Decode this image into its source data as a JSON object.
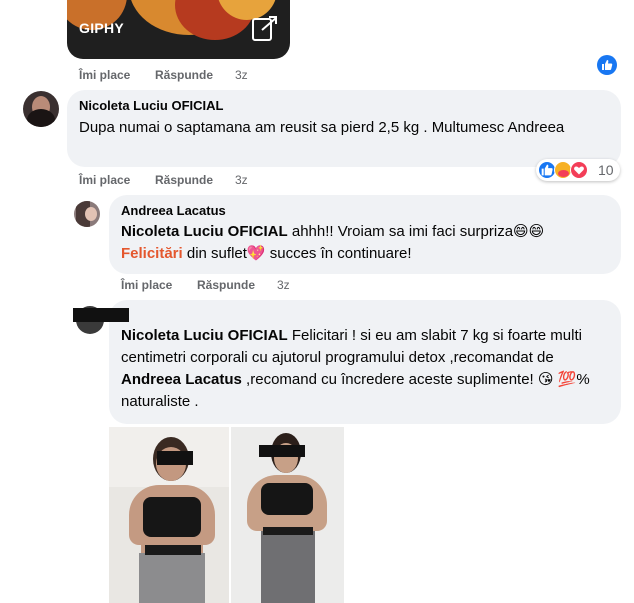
{
  "gif": {
    "label": "GIPHY"
  },
  "actions": {
    "like": "Îmi place",
    "reply": "Răspunde"
  },
  "comments": [
    {
      "time": "3z"
    },
    {
      "author": "Nicoleta Luciu OFICIAL",
      "text": "Dupa numai o saptamana am reusit sa pierd 2,5 kg . Multumesc Andreea",
      "time": "3z",
      "reaction_count": "10",
      "reaction_icons": [
        "like-icon",
        "care-icon",
        "love-icon"
      ]
    },
    {
      "author": "Andreea Lacatus",
      "mention": "Nicoleta Luciu OFICIAL",
      "text_a": " ahhh!! Vroiam sa imi faci surpriza😄😄",
      "felicitari": "Felicitări",
      "text_b": " din suflet💖 succes în continuare!",
      "time": "3z"
    },
    {
      "mention": "Nicoleta Luciu OFICIAL",
      "text_a": " Felicitari ! si eu am slabit 7 kg si foarte multi centimetri corporali cu ajutorul programului detox ,recomandat de ",
      "mention2": "Andreea Lacatus",
      "text_b": " ,recomand cu încredere aceste suplimente! 😘 💯% naturaliste ."
    }
  ],
  "colors": {
    "bubble": "#f0f2f5",
    "secondary_text": "#65676b",
    "like_blue": "#1877f2",
    "felicitari": "#e4572e"
  }
}
